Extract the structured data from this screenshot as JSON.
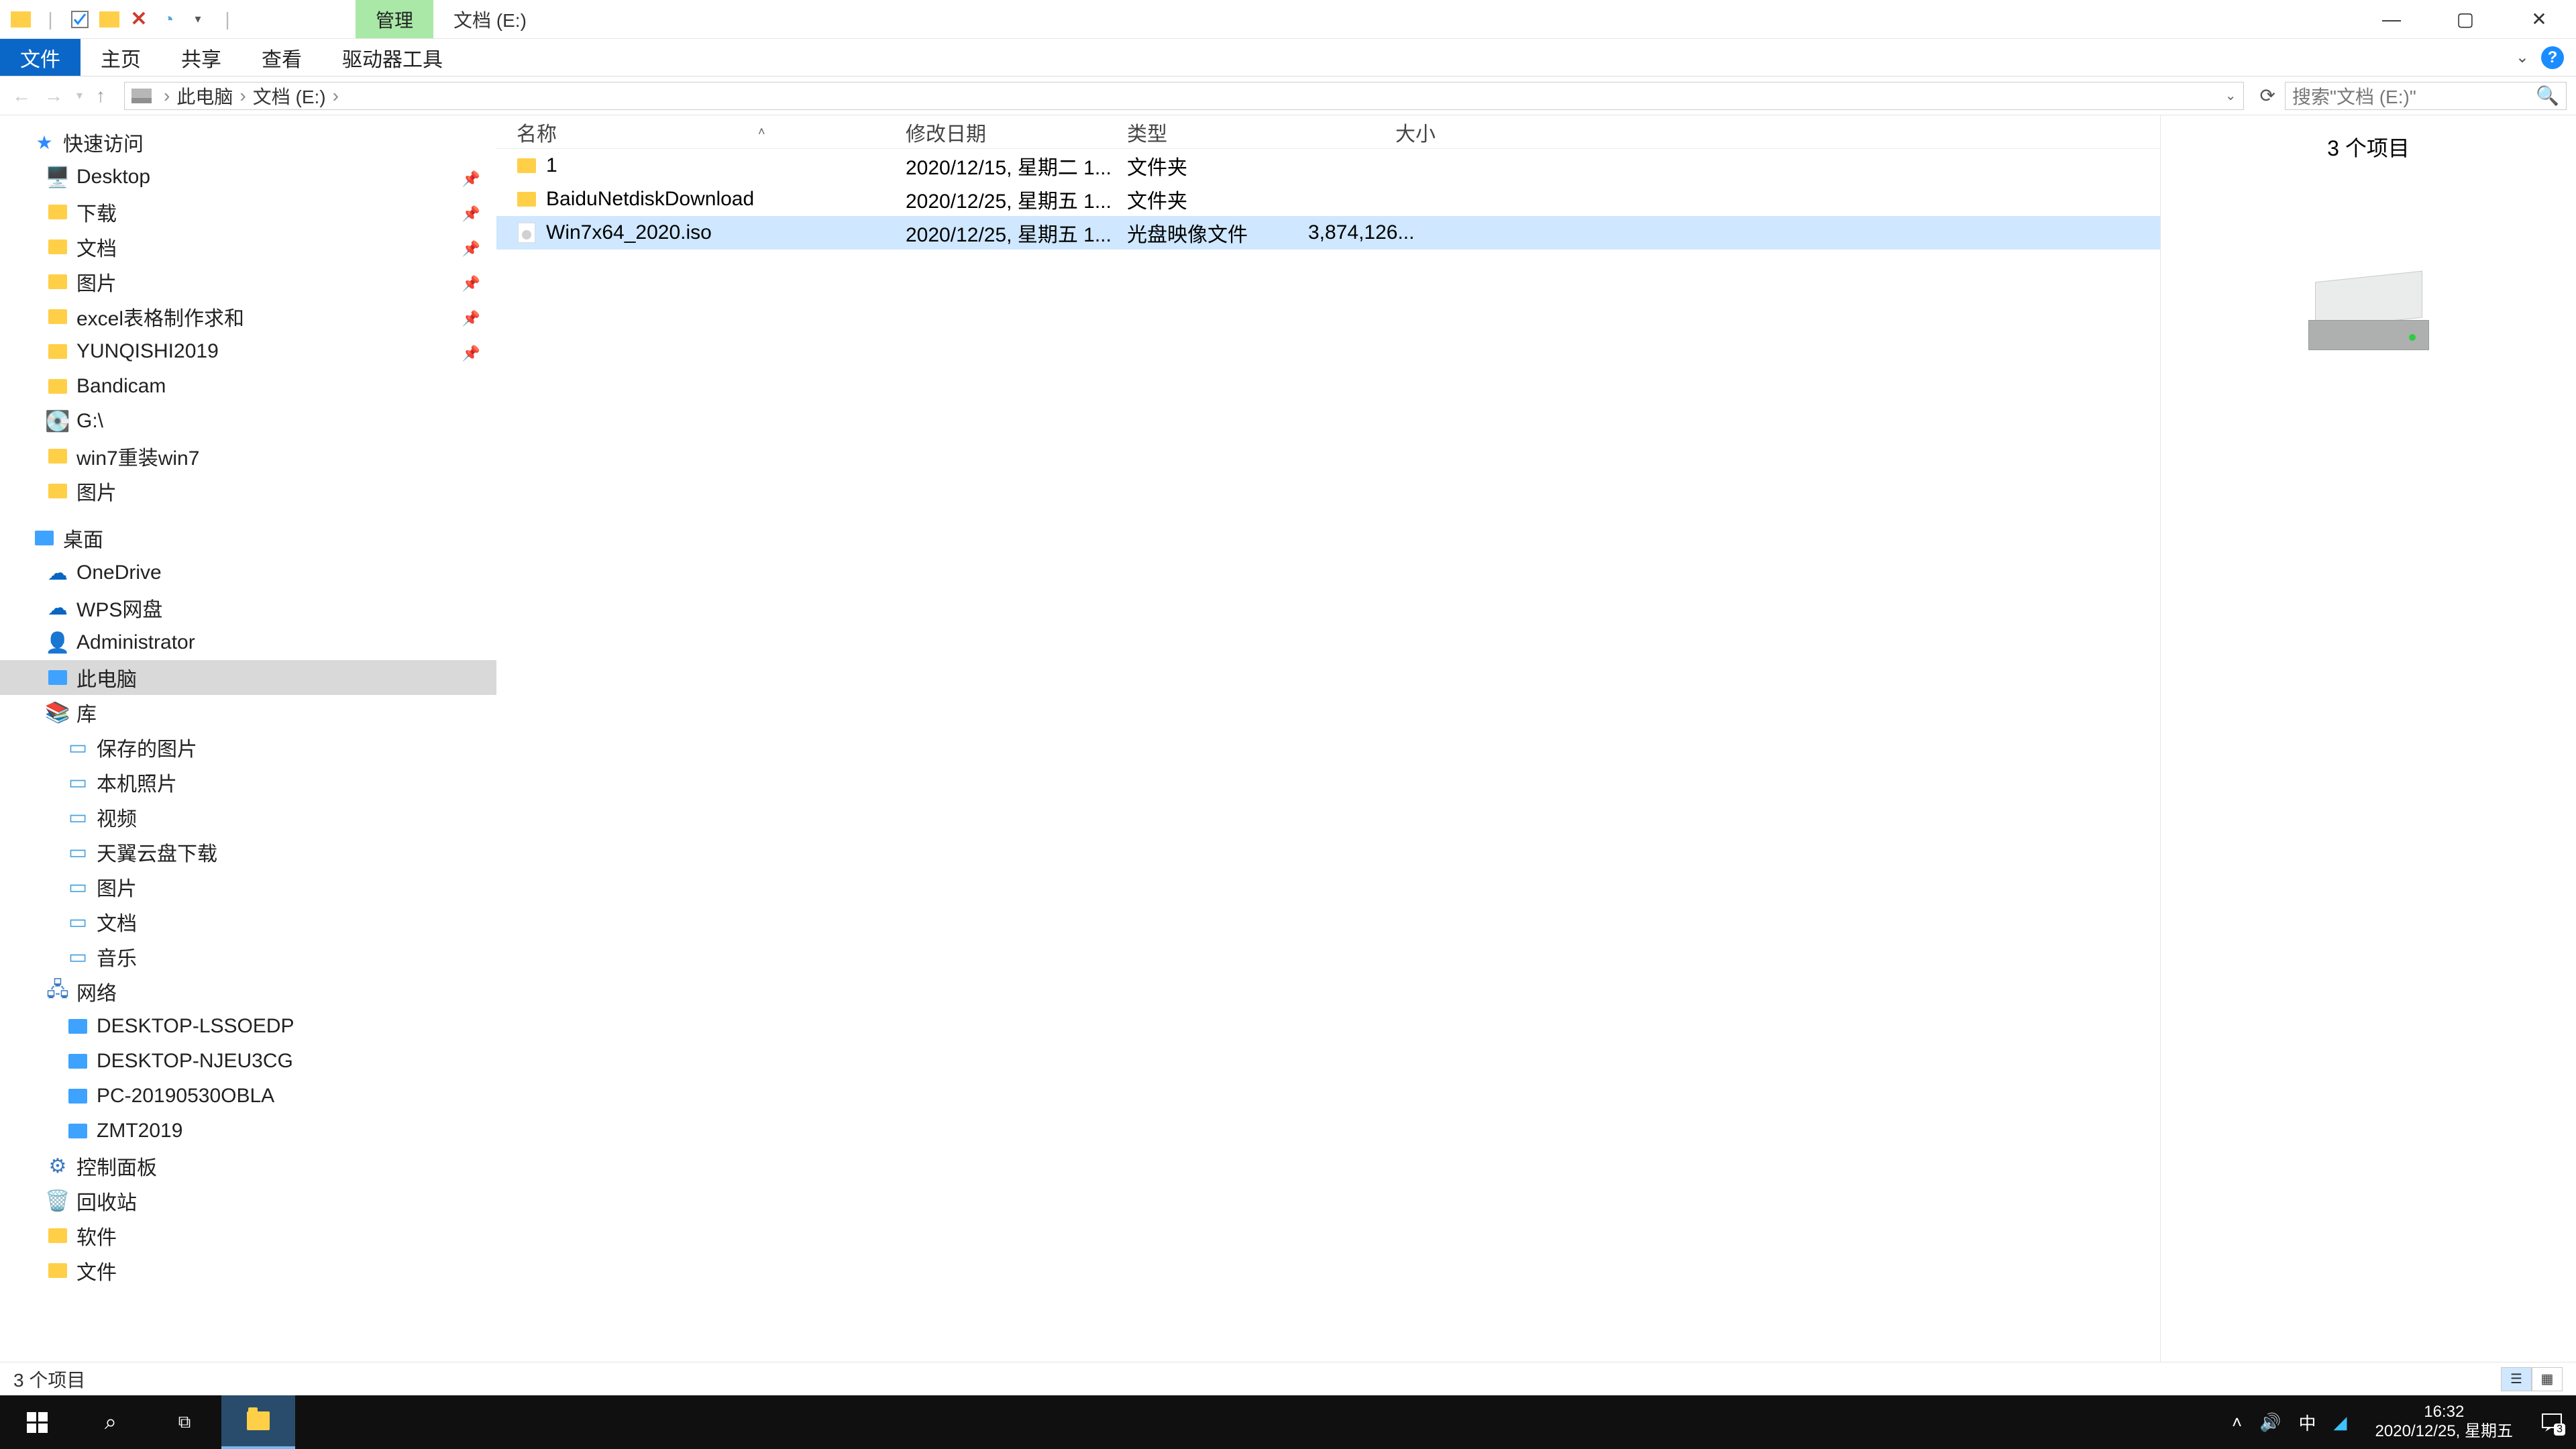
{
  "titlebar": {
    "context_tab": "管理",
    "title": "文档 (E:)"
  },
  "ribbon": {
    "file": "文件",
    "home": "主页",
    "share": "共享",
    "view": "查看",
    "drive_tools": "驱动器工具"
  },
  "breadcrumb": {
    "root": "此电脑",
    "loc": "文档 (E:)"
  },
  "search": {
    "placeholder": "搜索\"文档 (E:)\""
  },
  "nav": {
    "quick_access": "快速访问",
    "items_qa": [
      {
        "label": "Desktop",
        "pinned": true
      },
      {
        "label": "下载",
        "pinned": true
      },
      {
        "label": "文档",
        "pinned": true
      },
      {
        "label": "图片",
        "pinned": true
      },
      {
        "label": "excel表格制作求和",
        "pinned": true
      },
      {
        "label": "YUNQISHI2019",
        "pinned": true
      },
      {
        "label": "Bandicam"
      },
      {
        "label": "G:\\"
      },
      {
        "label": "win7重装win7"
      },
      {
        "label": "图片"
      }
    ],
    "desktop": "桌面",
    "onedrive": "OneDrive",
    "wps": "WPS网盘",
    "admin": "Administrator",
    "thispc": "此电脑",
    "libraries": "库",
    "lib_items": [
      "保存的图片",
      "本机照片",
      "视频",
      "天翼云盘下载",
      "图片",
      "文档",
      "音乐"
    ],
    "network": "网络",
    "net_items": [
      "DESKTOP-LSSOEDP",
      "DESKTOP-NJEU3CG",
      "PC-20190530OBLA",
      "ZMT2019"
    ],
    "control_panel": "控制面板",
    "recycle": "回收站",
    "soft": "软件",
    "docs": "文件"
  },
  "columns": {
    "name": "名称",
    "date": "修改日期",
    "type": "类型",
    "size": "大小"
  },
  "files": [
    {
      "name": "1",
      "date": "2020/12/15, 星期二 1...",
      "type": "文件夹",
      "size": "",
      "kind": "folder"
    },
    {
      "name": "BaiduNetdiskDownload",
      "date": "2020/12/25, 星期五 1...",
      "type": "文件夹",
      "size": "",
      "kind": "folder"
    },
    {
      "name": "Win7x64_2020.iso",
      "date": "2020/12/25, 星期五 1...",
      "type": "光盘映像文件",
      "size": "3,874,126...",
      "kind": "iso",
      "selected": true
    }
  ],
  "preview": {
    "count_label": "3 个项目"
  },
  "status": {
    "text": "3 个项目"
  },
  "tray": {
    "ime": "中",
    "time": "16:32",
    "date": "2020/12/25, 星期五",
    "badge": "3"
  }
}
